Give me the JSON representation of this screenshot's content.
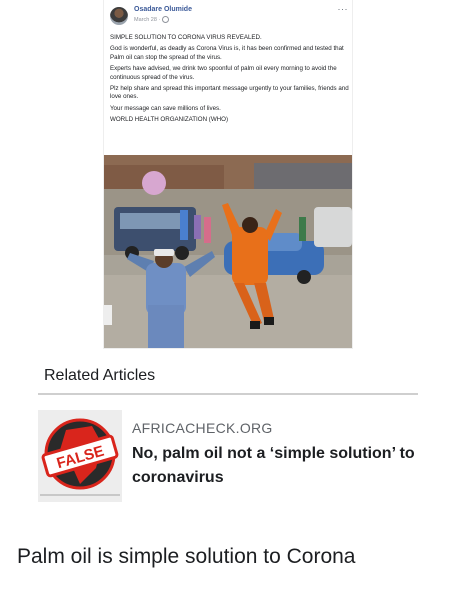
{
  "post": {
    "author": "Osadare Olumide",
    "meta": "March 28 ·",
    "more_label": "···",
    "paragraphs": [
      "SIMPLE SOLUTION TO CORONA VIRUS REVEALED.",
      "God is wonderful, as deadly as Corona Virus is, it has been confirmed and tested that Palm oil can stop the spread of the virus.",
      "Experts have advised, we drink two spoonful of palm oil every morning to avoid the continuous spread of the virus.",
      "Plz help share and spread this important message urgently to your families, friends and love ones.",
      "Your message can save millions of lives.",
      "WORLD HEALTH ORGANIZATION (WHO)"
    ]
  },
  "related": {
    "heading": "Related Articles",
    "article": {
      "source": "AFRICACHECK.ORG",
      "headline": "No, palm oil not a ‘simple solution’ to coronavirus",
      "stamp": "FALSE"
    }
  },
  "caption": "Palm oil is simple solution to Corona",
  "colors": {
    "author_link": "#3b5998",
    "stamp_red": "#d9251c",
    "orange_outfit": "#e8701a"
  }
}
